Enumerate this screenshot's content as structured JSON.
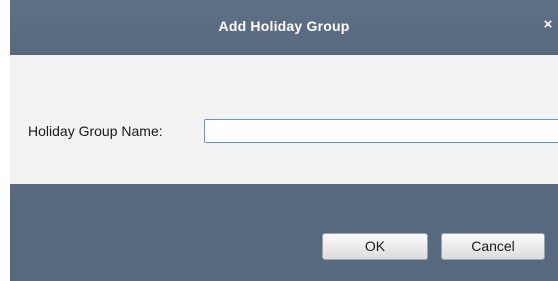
{
  "dialog": {
    "title": "Add Holiday Group",
    "close_glyph": "×",
    "close_icon": "close-icon"
  },
  "form": {
    "label": "Holiday Group Name:",
    "value": "",
    "placeholder": ""
  },
  "buttons": {
    "ok_label": "OK",
    "cancel_label": "Cancel"
  },
  "colors": {
    "titlebar": "#56697f",
    "footer": "#56697f",
    "body": "#f2f2f2",
    "input_focus_border": "#5b9bd5"
  }
}
